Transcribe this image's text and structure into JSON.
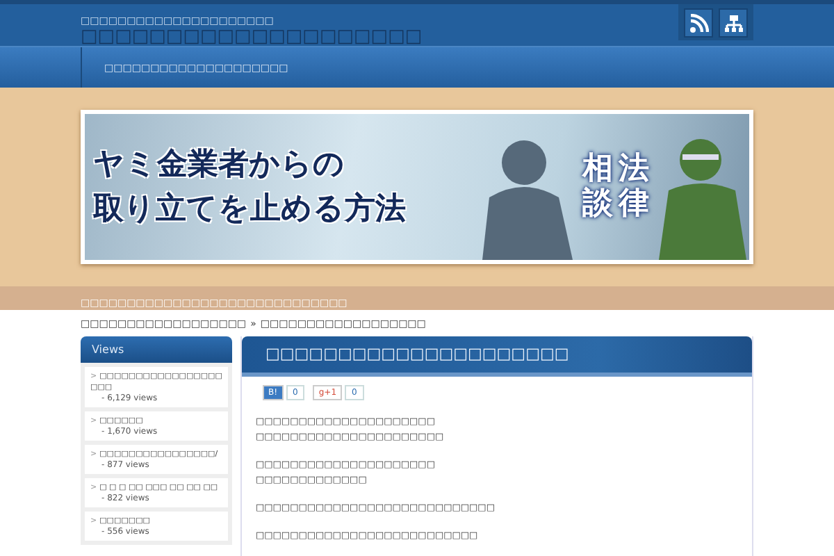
{
  "header": {
    "tagline": "□□□□□□□□□□□□□□□□□□□□□",
    "site_title": "□□□□□□□□□□□□□□□□□□□□"
  },
  "nav": {
    "items": [
      "□□□□□□□□□□□□□□□□□□□□"
    ]
  },
  "banner": {
    "headline_lines": [
      "ヤミ金業者からの",
      "取り立てを止める方法"
    ],
    "vertical_columns": [
      "相談",
      "法律"
    ]
  },
  "notice_bar": "□□□□□□□□□□□□□□□□□□□□□□□□□□□□□",
  "breadcrumb": [
    "□□□□□□□□□□□□□□□□□□",
    "□□□□□□□□□□□□□□□□□□"
  ],
  "breadcrumb_separator": "»",
  "sidebar": {
    "title": "Views",
    "bullet": ">",
    "items": [
      {
        "title": "□□□□□□□□□□□□□□□□□□□□",
        "views": "- 6,129 views"
      },
      {
        "title": "□□□□□□",
        "views": "- 1,670 views"
      },
      {
        "title": "□□□□□□□□□□□□□□□□/",
        "views": "- 877 views"
      },
      {
        "title": "□ □ □ □□ □□□ □□ □□ □□",
        "views": "- 822 views"
      },
      {
        "title": "□□□□□□□",
        "views": "- 556 views"
      }
    ]
  },
  "post": {
    "title": "□□□□□□□□□□□□□□□□□□□□□",
    "share": [
      {
        "kind": "hatena",
        "label": "B!",
        "count": "0"
      },
      {
        "kind": "gplus",
        "label": "g+1",
        "count": "0"
      }
    ],
    "paragraphs": [
      [
        "□□□□□□□□□□□□□□□□□□□□□",
        "□□□□□□□□□□□□□□□□□□□□□□"
      ],
      [
        "□□□□□□□□□□□□□□□□□□□□□",
        "□□□□□□□□□□□□□"
      ],
      [
        "□□□□□□□□□□□□□□□□□□□□□□□□□□□□"
      ],
      [
        "□□□□□□□□□□□□□□□□□□□□□□□□□□"
      ]
    ]
  }
}
